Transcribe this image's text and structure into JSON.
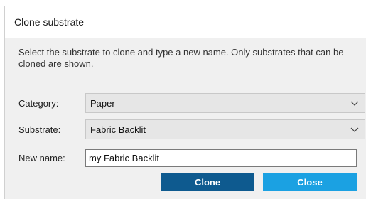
{
  "dialog": {
    "title": "Clone substrate",
    "description": "Select the substrate to clone and type a new name. Only substrates that can be cloned are shown."
  },
  "form": {
    "category_label": "Category:",
    "category_value": "Paper",
    "substrate_label": "Substrate:",
    "substrate_value": "Fabric Backlit",
    "new_name_label": "New name:",
    "new_name_value": "my Fabric Backlit"
  },
  "buttons": {
    "clone_label": "Clone",
    "close_label": "Close"
  },
  "icons": {
    "dropdown": "chevron-down-icon"
  },
  "colors": {
    "clone_button": "#0e5a8f",
    "close_button": "#1ba1e2"
  }
}
